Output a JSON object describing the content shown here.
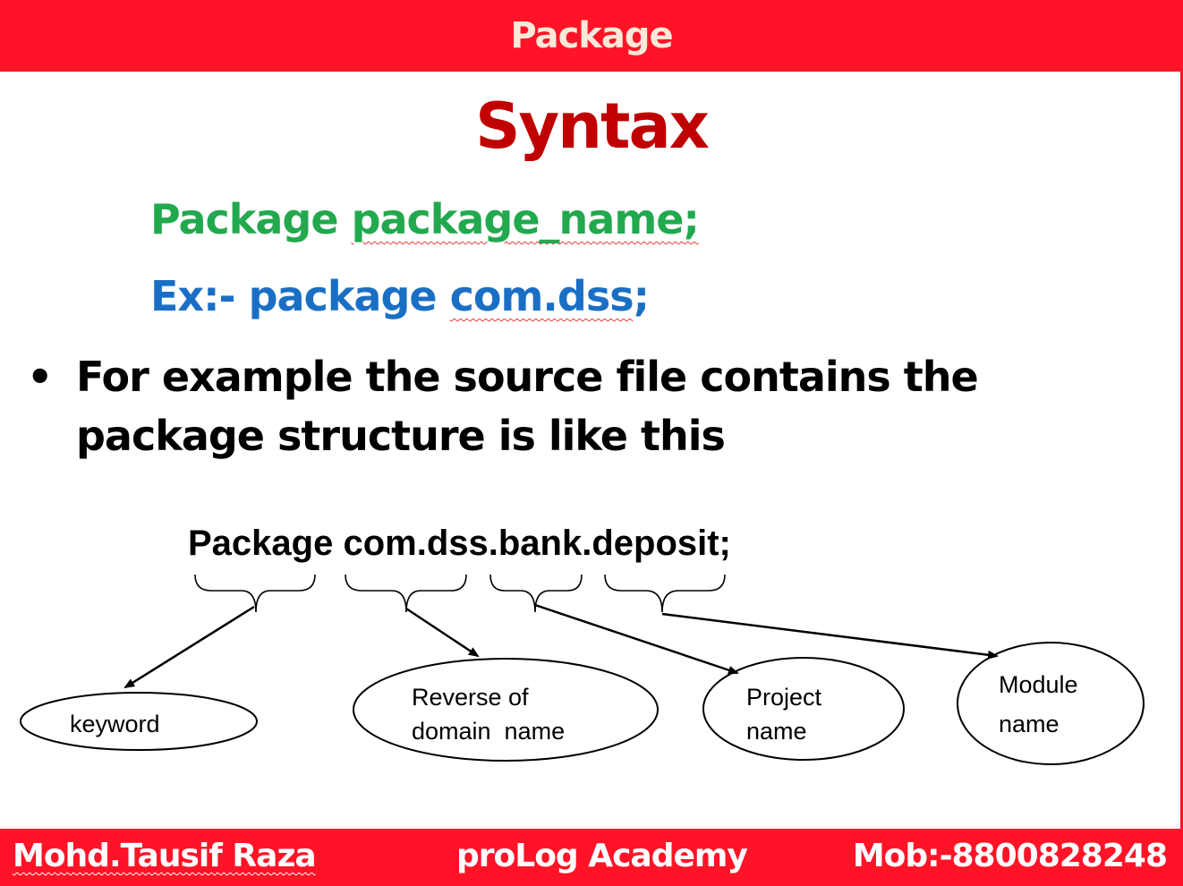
{
  "header": {
    "title": "Package"
  },
  "slide": {
    "heading": "Syntax",
    "syntax_keyword": "Package",
    "syntax_name": "package_name;",
    "example_prefix": "Ex:- package",
    "example_name": "com.dss",
    "example_suffix": ";",
    "bullet": "For example the source file contains the package structure is like this"
  },
  "diagram": {
    "statement": "Package com.dss.bank.deposit;",
    "labels": {
      "keyword": "keyword",
      "domain_line1": "Reverse of",
      "domain_line2": "domain  name",
      "project_line1": "Project",
      "project_line2": "name",
      "module_line1": "Module",
      "module_line2": "name"
    }
  },
  "footer": {
    "author": "Mohd.Tausif Raza",
    "academy": "proLog Academy",
    "mobile": "Mob:-8800828248"
  }
}
